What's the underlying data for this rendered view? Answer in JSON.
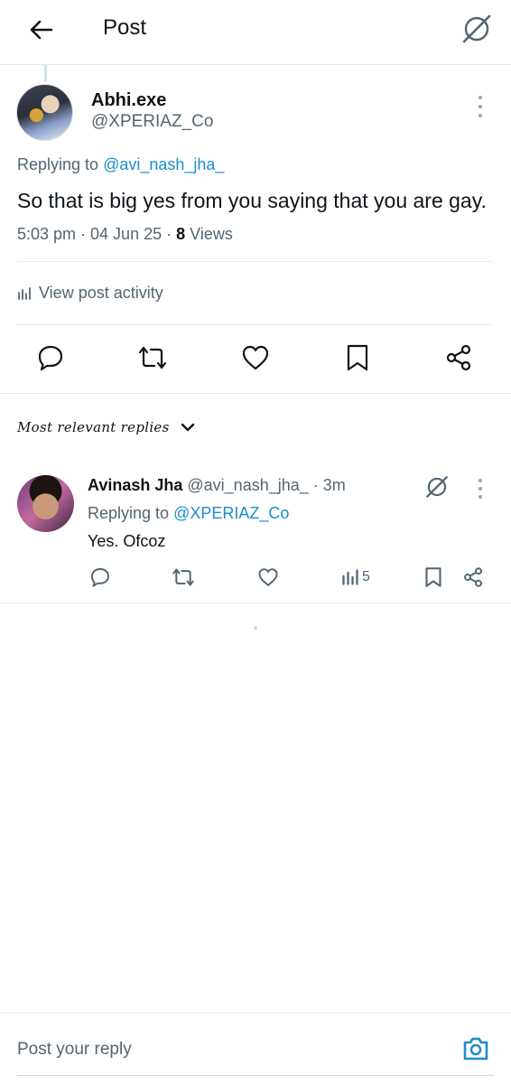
{
  "header": {
    "title": "Post"
  },
  "post": {
    "author_name": "Abhi.exe",
    "author_handle": "@XPERIAZ_Co",
    "replying_prefix": "Replying to",
    "replying_to": "@avi_nash_jha_",
    "text": "So that is big yes from you saying that you are gay.",
    "time": "5:03 pm · 04 Jun 25 ·",
    "views_count": "8",
    "views_label": "Views",
    "activity_label": "View post activity"
  },
  "replies_filter": {
    "label": "Most relevant replies"
  },
  "reply": {
    "author_name": "Avinash Jha",
    "author_handle": "@avi_nash_jha_",
    "time": "· 3m",
    "replying_prefix": "Replying to",
    "replying_to": "@XPERIAZ_Co",
    "text": "Yes. Ofcoz",
    "views": "5"
  },
  "compose": {
    "placeholder": "Post your reply"
  },
  "colors": {
    "link": "#1d8ec8",
    "muted": "#536471",
    "text": "#0f1419"
  },
  "icons": [
    "back-arrow-icon",
    "grok-icon",
    "more-vertical-icon",
    "reply-icon",
    "repost-icon",
    "like-icon",
    "bookmark-icon",
    "share-icon",
    "analytics-icon",
    "chevron-down-icon",
    "camera-icon"
  ]
}
